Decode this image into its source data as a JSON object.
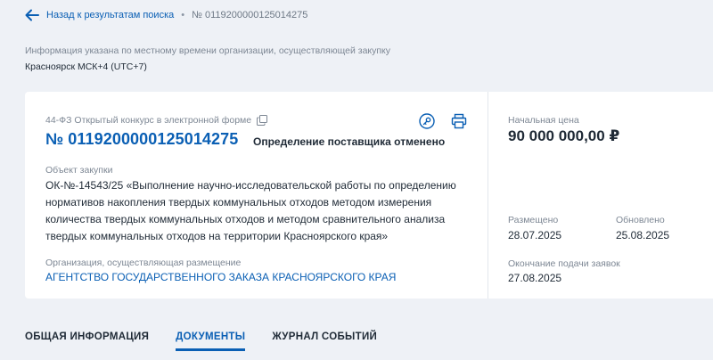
{
  "breadcrumb": {
    "back_label": "Назад к результатам поиска",
    "separator": "•",
    "current": "№ 0119200000125014275"
  },
  "timezone": {
    "note": "Информация указана по местному времени организации, осуществляющей закупку",
    "value": "Красноярск МСК+4 (UTC+7)"
  },
  "card": {
    "law": "44-ФЗ Открытый конкурс в электронной форме",
    "number": "№ 0119200000125014275",
    "status": "Определение поставщика отменено",
    "object_label": "Объект закупки",
    "object_text": "ОК-№-14543/25 «Выполнение научно-исследовательской работы по определению нормативов накопления твердых коммунальных отходов методом измерения количества твердых коммунальных отходов и методом сравнительного анализа твердых коммунальных отходов на территории Красноярского края»",
    "org_label": "Организация, осуществляющая размещение",
    "org_name": "АГЕНТСТВО ГОСУДАРСТВЕННОГО ЗАКАЗА КРАСНОЯРСКОГО КРАЯ"
  },
  "side": {
    "price_label": "Начальная цена",
    "price_value": "90 000 000,00 ₽",
    "posted_label": "Размещено",
    "posted_value": "28.07.2025",
    "updated_label": "Обновлено",
    "updated_value": "25.08.2025",
    "deadline_label": "Окончание подачи заявок",
    "deadline_value": "27.08.2025"
  },
  "tabs": [
    {
      "label": "ОБЩАЯ ИНФОРМАЦИЯ",
      "active": false
    },
    {
      "label": "ДОКУМЕНТЫ",
      "active": true
    },
    {
      "label": "ЖУРНАЛ СОБЫТИЙ",
      "active": false
    }
  ],
  "icons": {
    "back": "arrow-left-icon",
    "copy": "copy-icon",
    "key": "key-icon",
    "print": "printer-icon"
  },
  "colors": {
    "accent": "#0a5fb4",
    "background": "#eef1f6",
    "muted_text": "#7d8794"
  }
}
